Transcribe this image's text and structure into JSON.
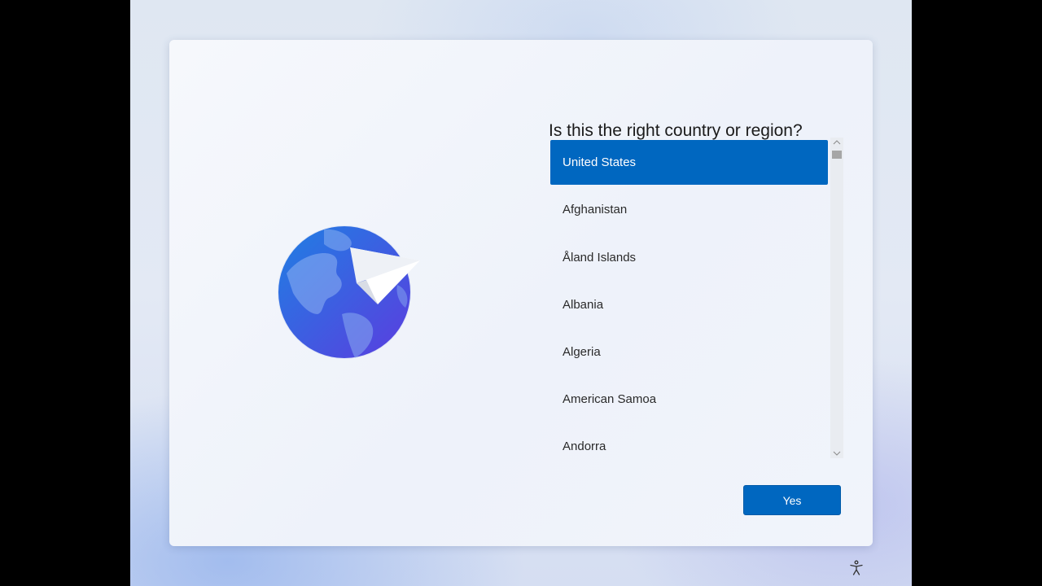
{
  "page": {
    "title": "Is this the right country or region?"
  },
  "country_list": {
    "selected": "United States",
    "items": [
      {
        "label": "United States",
        "selected": true
      },
      {
        "label": "Afghanistan",
        "selected": false
      },
      {
        "label": "Åland Islands",
        "selected": false
      },
      {
        "label": "Albania",
        "selected": false
      },
      {
        "label": "Algeria",
        "selected": false
      },
      {
        "label": "American Samoa",
        "selected": false
      },
      {
        "label": "Andorra",
        "selected": false
      }
    ]
  },
  "actions": {
    "yes_label": "Yes"
  },
  "icons": {
    "illustration": "globe-paper-plane-icon",
    "scroll_up": "chevron-up-icon",
    "scroll_down": "chevron-down-icon",
    "accessibility": "accessibility-icon"
  },
  "colors": {
    "accent": "#0067c0",
    "selected_text": "#ffffff",
    "globe_light": "#2a7be0",
    "globe_dark": "#5a3fe0"
  }
}
